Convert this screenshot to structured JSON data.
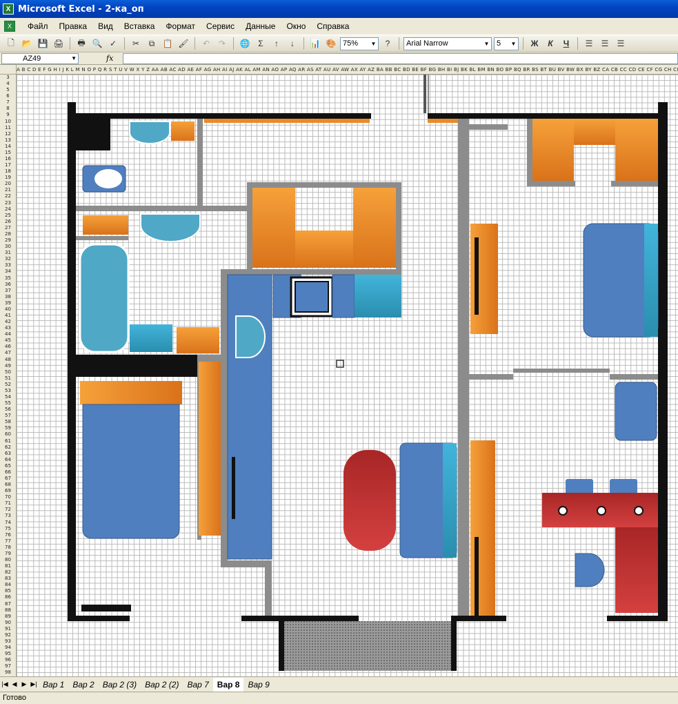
{
  "window": {
    "title": "Microsoft Excel - 2-ка_оп",
    "app_icon": "excel-icon"
  },
  "menu": [
    "Файл",
    "Правка",
    "Вид",
    "Вставка",
    "Формат",
    "Сервис",
    "Данные",
    "Окно",
    "Справка"
  ],
  "toolbar": {
    "zoom": "75%",
    "font_name": "Arial Narrow",
    "font_size": "5",
    "bold": "Ж",
    "italic": "К",
    "underline": "Ч",
    "sigma": "Σ"
  },
  "formula_bar": {
    "name_box": "AZ49",
    "fx_label": "fx",
    "value": ""
  },
  "columns_text": "A B C D E F G H I J K L M N O P Q R S T U V W X Y Z AA AB AC AD AE AF AG AH AI AJ AK AL AM AN AO AP AQ AR AS AT AU AV AW AX AY AZ BA BB BC BD BE BF BG BH BI BJ BK BL BM BN BO BP BQ BR BS BT BU BV BW BX BY BZ CA CB CC CD CE CF CG CH CI CJ CK CL CM CN CO CP CQ CR CS CT CU CV CW CX CY CZ DA DB DC DD DE",
  "row_start": 3,
  "row_end": 98,
  "sheet_tabs": [
    "Вар 1",
    "Вар 2",
    "Вар 2 (3)",
    "Вар 2 (2)",
    "Вар 7",
    "Вар 8",
    "Вар 9"
  ],
  "active_tab": "Вар 8",
  "status": "Готово",
  "colors": {
    "wall": "#111111",
    "partition": "#8c8c8c",
    "orange": "#f08a24",
    "blue": "#4f7fbf",
    "cyan": "#3aa8cc",
    "red": "#c33232"
  }
}
